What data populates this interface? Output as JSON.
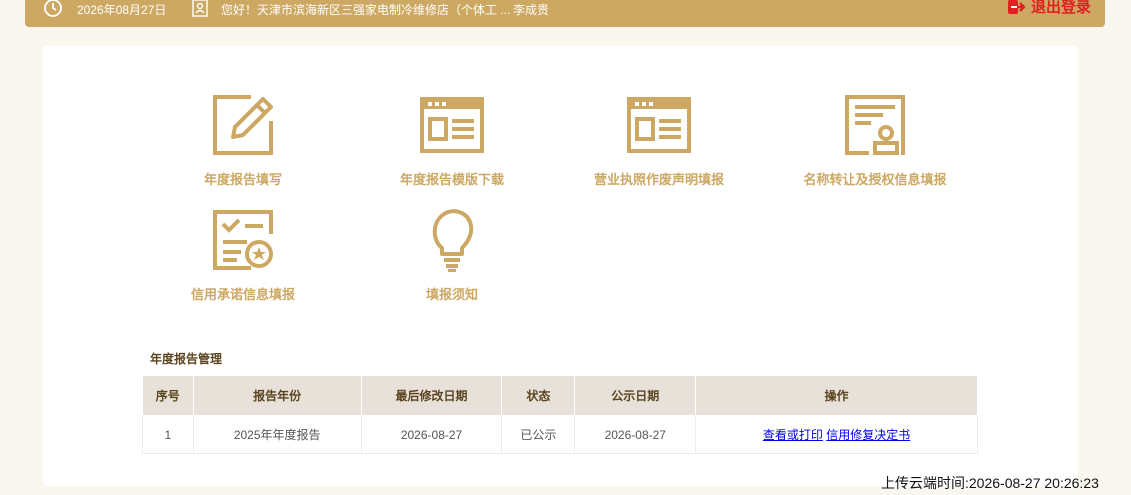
{
  "topbar": {
    "date": "2026年08月27日",
    "greeting": "您好！天津市滨海新区三强家电制冷维修店（个体工 ...",
    "user_name": "李成贵",
    "logout_label": "退出登录"
  },
  "tiles": [
    {
      "label": "年度报告填写",
      "icon": "edit-form-icon"
    },
    {
      "label": "年度报告模版下载",
      "icon": "template-download-icon"
    },
    {
      "label": "营业执照作废声明填报",
      "icon": "license-void-icon"
    },
    {
      "label": "名称转让及授权信息填报",
      "icon": "authorization-stamp-icon"
    },
    {
      "label": "信用承诺信息填报",
      "icon": "credit-checklist-icon"
    },
    {
      "label": "填报须知",
      "icon": "lightbulb-icon"
    }
  ],
  "report_section": {
    "title": "年度报告管理",
    "columns": [
      "序号",
      "报告年份",
      "最后修改日期",
      "状态",
      "公示日期",
      "操作"
    ],
    "rows": [
      {
        "index": "1",
        "year": "2025年年度报告",
        "modified": "2026-08-27",
        "status": "已公示",
        "publish_date": "2026-08-27",
        "actions": [
          "查看或打印",
          "信用修复决定书"
        ]
      }
    ]
  },
  "upload_time": "上传云端时间:2026-08-27 20:26:23",
  "colors": {
    "accent": "#cda863",
    "logout": "#e02020",
    "header_bg": "#e8e1d9",
    "link": "#0000ee"
  }
}
